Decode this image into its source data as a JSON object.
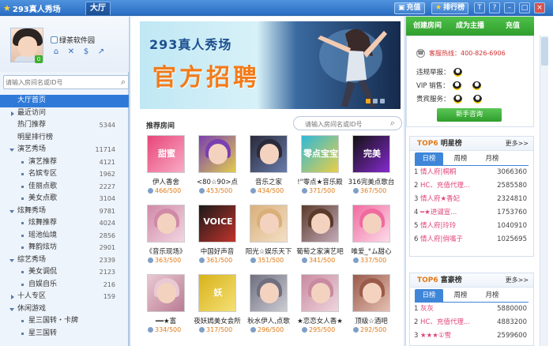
{
  "titlebar": {
    "logo": "293真人秀场",
    "tab": "大厅",
    "recharge": "充值",
    "ranking": "排行榜",
    "icons": [
      "shirt-icon",
      "help-icon",
      "minimize-icon",
      "maximize-icon",
      "close-icon"
    ]
  },
  "profile": {
    "username": "绿茶软件园",
    "level": "0",
    "icons": [
      "home-icon",
      "tools-icon",
      "coin-icon",
      "share-icon"
    ]
  },
  "left_search": {
    "placeholder": "请输入房间名或ID号"
  },
  "menu": [
    {
      "label": "大厅首页",
      "type": "sel",
      "count": ""
    },
    {
      "label": "最近访问",
      "type": "cat",
      "count": ""
    },
    {
      "label": "热门推荐",
      "type": "plain",
      "count": "5344"
    },
    {
      "label": "明星排行榜",
      "type": "plain",
      "count": ""
    },
    {
      "label": "演艺秀场",
      "type": "open",
      "count": "11714"
    },
    {
      "label": "演艺推荐",
      "type": "sub",
      "count": "4121"
    },
    {
      "label": "名嫔专区",
      "type": "sub",
      "count": "1962"
    },
    {
      "label": "佳丽点歌",
      "type": "sub",
      "count": "2227"
    },
    {
      "label": "美女点歌",
      "type": "sub",
      "count": "3104"
    },
    {
      "label": "炫舞秀场",
      "type": "open",
      "count": "9781"
    },
    {
      "label": "炫舞推荐",
      "type": "sub",
      "count": "4024"
    },
    {
      "label": "瑶池仙境",
      "type": "sub",
      "count": "2856"
    },
    {
      "label": "舞韵炫坊",
      "type": "sub",
      "count": "2901"
    },
    {
      "label": "综艺秀场",
      "type": "open",
      "count": "2339"
    },
    {
      "label": "美女调侃",
      "type": "sub",
      "count": "2123"
    },
    {
      "label": "自娱自乐",
      "type": "sub",
      "count": "216"
    },
    {
      "label": "十人专区",
      "type": "cat",
      "count": "159"
    },
    {
      "label": "休闲游戏",
      "type": "open",
      "count": ""
    },
    {
      "label": "星三国转・卡牌",
      "type": "sub",
      "count": ""
    },
    {
      "label": "星三国转",
      "type": "sub",
      "count": ""
    }
  ],
  "banner": {
    "title": "293真人秀场",
    "headline": "官方招聘"
  },
  "recommended": {
    "title": "推荐房间",
    "search_placeholder": "请输入房间名或ID号",
    "rooms": [
      {
        "name": "伊人香舍",
        "count": "466/500",
        "thumb_text": "甜蜜",
        "c1": "#e8457a",
        "c2": "#f9b0c8"
      },
      {
        "name": "<80☆90>点",
        "count": "453/500",
        "thumb_text": "",
        "c1": "#7a3fb0",
        "c2": "#e6d34a"
      },
      {
        "name": "音乐之家",
        "count": "434/500",
        "thumb_text": "",
        "c1": "#2a2a3a",
        "c2": "#6a7fb0"
      },
      {
        "name": "!\"零点★音乐殿",
        "count": "371/500",
        "thumb_text": "零点宝宝",
        "c1": "#2fb8d6",
        "c2": "#f2d040"
      },
      {
        "name": "316完美点歌台",
        "count": "367/500",
        "thumb_text": "完美",
        "c1": "#111111",
        "c2": "#8b2bd8"
      },
      {
        "name": "《音乐现场》",
        "count": "363/500",
        "thumb_text": "",
        "c1": "#d08aa8",
        "c2": "#f3d9e4"
      },
      {
        "name": "中国好声音",
        "count": "361/500",
        "thumb_text": "VOICE",
        "c1": "#1a1a1a",
        "c2": "#c9342c"
      },
      {
        "name": "阳光☆娱乐天下",
        "count": "351/500",
        "thumb_text": "",
        "c1": "#d9b07a",
        "c2": "#f5e1c8"
      },
      {
        "name": "葡萄之家演艺吧",
        "count": "341/500",
        "thumb_text": "",
        "c1": "#5a3a2a",
        "c2": "#c9b0c0"
      },
      {
        "name": "唯爱_°ム甜心",
        "count": "337/500",
        "thumb_text": "",
        "c1": "#f06aa0",
        "c2": "#fde1ec"
      },
      {
        "name": "━━★富",
        "count": "334/500",
        "thumb_text": "",
        "c1": "#e9c9d3",
        "c2": "#b87890"
      },
      {
        "name": "夜妖嫣美女会所",
        "count": "317/500",
        "thumb_text": "妖",
        "c1": "#d8b21a",
        "c2": "#f5e27a"
      },
      {
        "name": "秋水伊人,点歌",
        "count": "296/500",
        "thumb_text": "",
        "c1": "#6f6f80",
        "c2": "#d0d0d8"
      },
      {
        "name": "★恋恋女人香★",
        "count": "295/500",
        "thumb_text": "",
        "c1": "#c88aa0",
        "c2": "#f1d8e0"
      },
      {
        "name": "顶级☆酒吧",
        "count": "292/500",
        "thumb_text": "",
        "c1": "#9a5a4a",
        "c2": "#e8c4b8"
      }
    ]
  },
  "service": {
    "tabs": [
      "创建房间",
      "成为主播",
      "充值"
    ],
    "hotline": "客服热线：400-826-6906",
    "rows": [
      {
        "label": "违规举报："
      },
      {
        "label": "VIP 销售："
      },
      {
        "label": "贵宾服务："
      }
    ],
    "consult_button": "新手咨询"
  },
  "star_rank": {
    "top": "TOP6",
    "title": "明星榜",
    "more": "更多>>",
    "tabs": [
      "日榜",
      "周榜",
      "月榜"
    ],
    "rows": [
      {
        "idx": "1",
        "name": "情人府|桐桐",
        "value": "3066360"
      },
      {
        "idx": "2",
        "name": "HC、充值代理...",
        "value": "2585580"
      },
      {
        "idx": "3",
        "name": "情人府★香妃",
        "value": "2324810"
      },
      {
        "idx": "4",
        "name": "━★进谴宣...",
        "value": "1753760"
      },
      {
        "idx": "5",
        "name": "情人府|玲玲",
        "value": "1040910"
      },
      {
        "idx": "6",
        "name": "情人府|俏嘴子",
        "value": "1025695"
      }
    ]
  },
  "rich_rank": {
    "top": "TOP6",
    "title": "富豪榜",
    "more": "更多>>",
    "tabs": [
      "日榜",
      "周榜",
      "月榜"
    ],
    "rows": [
      {
        "idx": "1",
        "name": "灰灰",
        "value": "5880000"
      },
      {
        "idx": "2",
        "name": "HC、充值代理...",
        "value": "4883200"
      },
      {
        "idx": "3",
        "name": "★★★①雪",
        "value": "2599600"
      }
    ]
  }
}
